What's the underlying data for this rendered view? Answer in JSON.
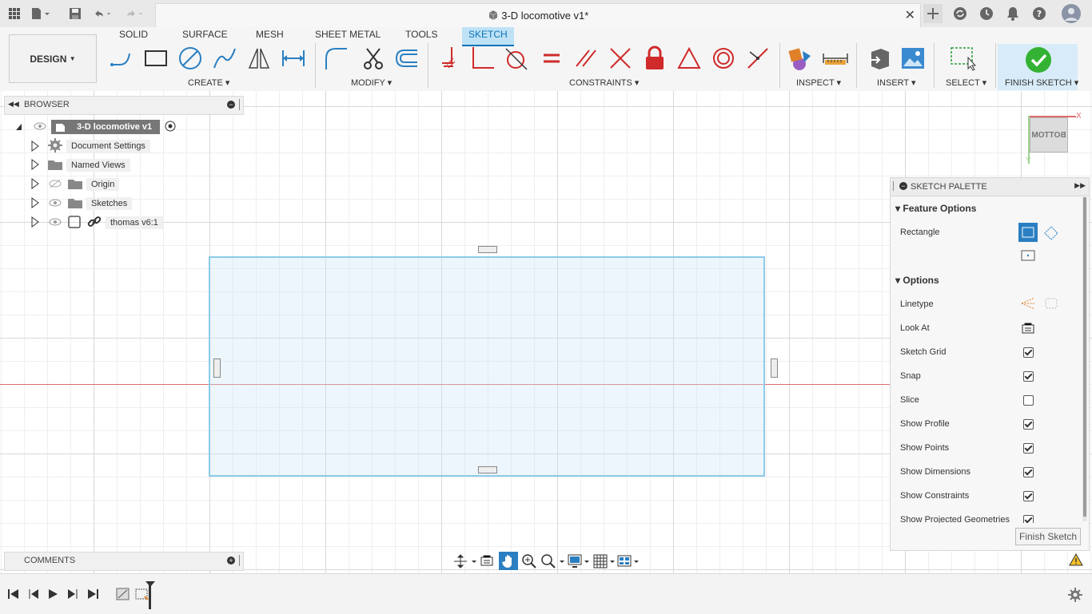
{
  "app": {
    "document_title": "3-D locomotive v1*",
    "accent": "#0b74b8"
  },
  "toolbar": {
    "design_label": "DESIGN",
    "workspace_tabs": [
      "SOLID",
      "SURFACE",
      "MESH",
      "SHEET METAL",
      "TOOLS",
      "SKETCH"
    ],
    "active_tab": "SKETCH",
    "groups": {
      "create": "CREATE",
      "modify": "MODIFY",
      "constraints": "CONSTRAINTS",
      "inspect": "INSPECT",
      "insert": "INSERT",
      "select": "SELECT",
      "finish": "FINISH SKETCH"
    }
  },
  "browser": {
    "header": "BROWSER",
    "root": "3-D locomotive v1",
    "items": [
      {
        "label": "Document Settings",
        "icon": "gear-icon"
      },
      {
        "label": "Named Views",
        "icon": "folder-icon"
      },
      {
        "label": "Origin",
        "icon": "folder-icon"
      },
      {
        "label": "Sketches",
        "icon": "folder-icon"
      },
      {
        "label": "thomas v6:1",
        "icon": "component-icon"
      }
    ]
  },
  "comments": {
    "header": "COMMENTS"
  },
  "palette": {
    "header": "SKETCH PALETTE",
    "feature_options": "Feature Options",
    "rectangle_label": "Rectangle",
    "options": "Options",
    "rows": [
      {
        "label": "Linetype",
        "type": "icons"
      },
      {
        "label": "Look At",
        "type": "icon"
      },
      {
        "label": "Sketch Grid",
        "checked": true
      },
      {
        "label": "Snap",
        "checked": true
      },
      {
        "label": "Slice",
        "checked": false
      },
      {
        "label": "Show Profile",
        "checked": true
      },
      {
        "label": "Show Points",
        "checked": true
      },
      {
        "label": "Show Dimensions",
        "checked": true
      },
      {
        "label": "Show Constraints",
        "checked": true
      },
      {
        "label": "Show Projected Geometries",
        "checked": true
      }
    ],
    "finish_button": "Finish Sketch"
  },
  "viewcube": {
    "face": "BOTTOM",
    "axis_x": "X",
    "axis_y": "Y"
  }
}
